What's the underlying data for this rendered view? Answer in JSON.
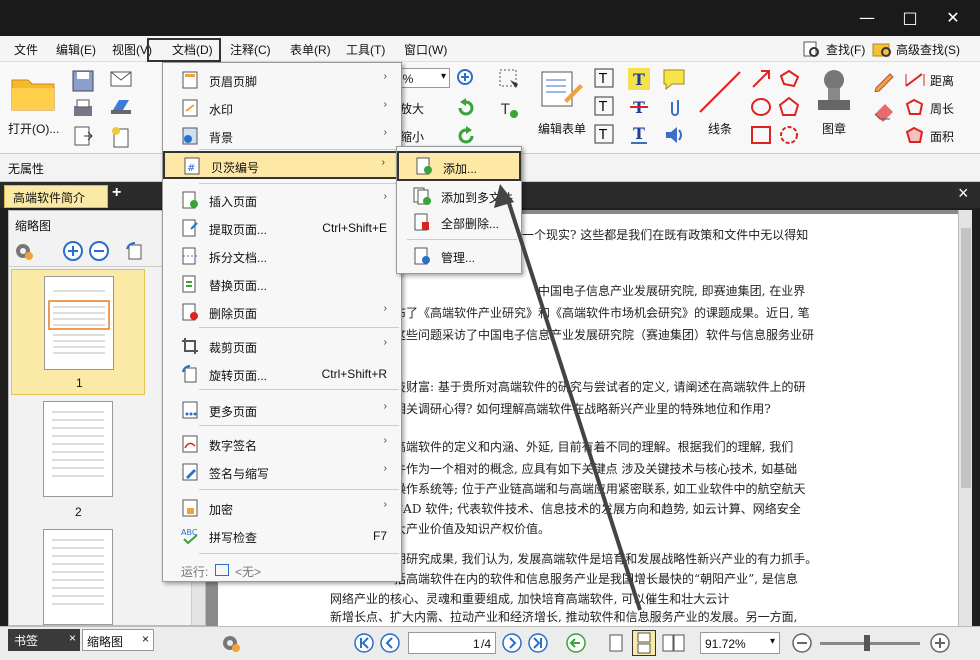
{
  "menubar": {
    "items": [
      "文件",
      "编辑(E)",
      "视图(V)",
      "文档(D)",
      "注释(C)",
      "表单(R)",
      "工具(T)",
      "窗口(W)"
    ],
    "find": "查找(F)",
    "advanced_find": "高级查找(S)"
  },
  "toolbar": {
    "open": "打开(O)...",
    "zoom_value": "2%",
    "enlarge": "放大",
    "shrink": "缩小",
    "edit_form": "编辑表单",
    "line": "线条",
    "stamp": "图章",
    "distance": "距离",
    "perimeter": "周长",
    "area": "面积"
  },
  "properties": {
    "label": "无属性"
  },
  "tabs": {
    "doc_tab": "高端软件简介",
    "add": "+",
    "close": "×"
  },
  "left_panel": {
    "title": "缩略图",
    "thumbs": [
      "1",
      "2"
    ],
    "bottom_tabs": [
      "书签",
      "缩略图"
    ]
  },
  "dropdown": {
    "items": [
      {
        "label": "页眉页脚",
        "shortcut": "",
        "arrow": "›"
      },
      {
        "label": "水印",
        "shortcut": "",
        "arrow": "›"
      },
      {
        "label": "背景",
        "shortcut": "",
        "arrow": "›"
      },
      {
        "label": "贝茨编号",
        "shortcut": "",
        "arrow": "›"
      },
      {
        "label": "插入页面",
        "shortcut": "",
        "arrow": "›"
      },
      {
        "label": "提取页面...",
        "shortcut": "Ctrl+Shift+E",
        "arrow": ""
      },
      {
        "label": "拆分文档...",
        "shortcut": "",
        "arrow": ""
      },
      {
        "label": "替换页面...",
        "shortcut": "",
        "arrow": ""
      },
      {
        "label": "删除页面",
        "shortcut": "",
        "arrow": "›"
      },
      {
        "label": "裁剪页面",
        "shortcut": "",
        "arrow": "›"
      },
      {
        "label": "旋转页面...",
        "shortcut": "Ctrl+Shift+R",
        "arrow": ""
      },
      {
        "label": "更多页面",
        "shortcut": "",
        "arrow": "›"
      },
      {
        "label": "数字签名",
        "shortcut": "",
        "arrow": "›"
      },
      {
        "label": "签名与缩写",
        "shortcut": "",
        "arrow": "›"
      },
      {
        "label": "加密",
        "shortcut": "",
        "arrow": "›"
      },
      {
        "label": "拼写检查",
        "shortcut": "F7",
        "arrow": ""
      }
    ],
    "run_label": "运行:",
    "run_value": "<无>"
  },
  "submenu": {
    "items": [
      "添加...",
      "添加到多文件",
      "全部删除...",
      "管理..."
    ]
  },
  "document": {
    "lines": [
      "一个现实? 这些都是我们在既有政策和文件中无以得知",
      "中国电子信息产业发展研究院, 即赛迪集团, 在业界",
      "布了《高端软件产业研究》和《高端软件市场机会研究》的课题成果。近日, 笔",
      "这些问题采访了中国电子信息产业发展研究院（赛迪集团）软件与信息服务业研",
      "技财富: 基于贵所对高端软件的研究与尝试者的定义, 请阐述在高端软件上的研",
      "相关调研心得? 如何理解高端软件在战略新兴产业里的特殊地位和作用?",
      "高端软件的定义和内涵、外延, 目前有着不同的理解。根据我们的理解, 我们",
      "件作为一个相对的概念, 应具有如下关键点 涉及关键技术与核心技术, 如基础",
      "操作系统等; 位于产业链高端和与高端应用紧密联系, 如工业软件中的航空航天",
      "CAD 软件; 代表软件技术、信息技术的发展方向和趋势, 如云计算、网络安全",
      "大产业价值及知识产权价值。",
      "期研究成果, 我们认为, 发展高端软件是培育和发展战略性新兴产业的有力抓手。",
      "括高端软件在内的软件和信息服务产业是我国增长最快的“朝阳产业”, 是信息",
      "网络产业的核心、灵魂和重要组成, 加快培育高端软件, 可以催生和壮大云计",
      "新增长点、扩大内需、拉动产业和经济增长, 推动软件和信息服务产业的发展。另一方面,"
    ]
  },
  "statusbar": {
    "page_value": "1",
    "page_total": "/4",
    "zoom": "91.72%"
  },
  "watermark": "百度经验",
  "colors": {
    "accent": "#f5c842",
    "highlight": "#fbe9a6",
    "menu_hover": "#fde8a5"
  }
}
